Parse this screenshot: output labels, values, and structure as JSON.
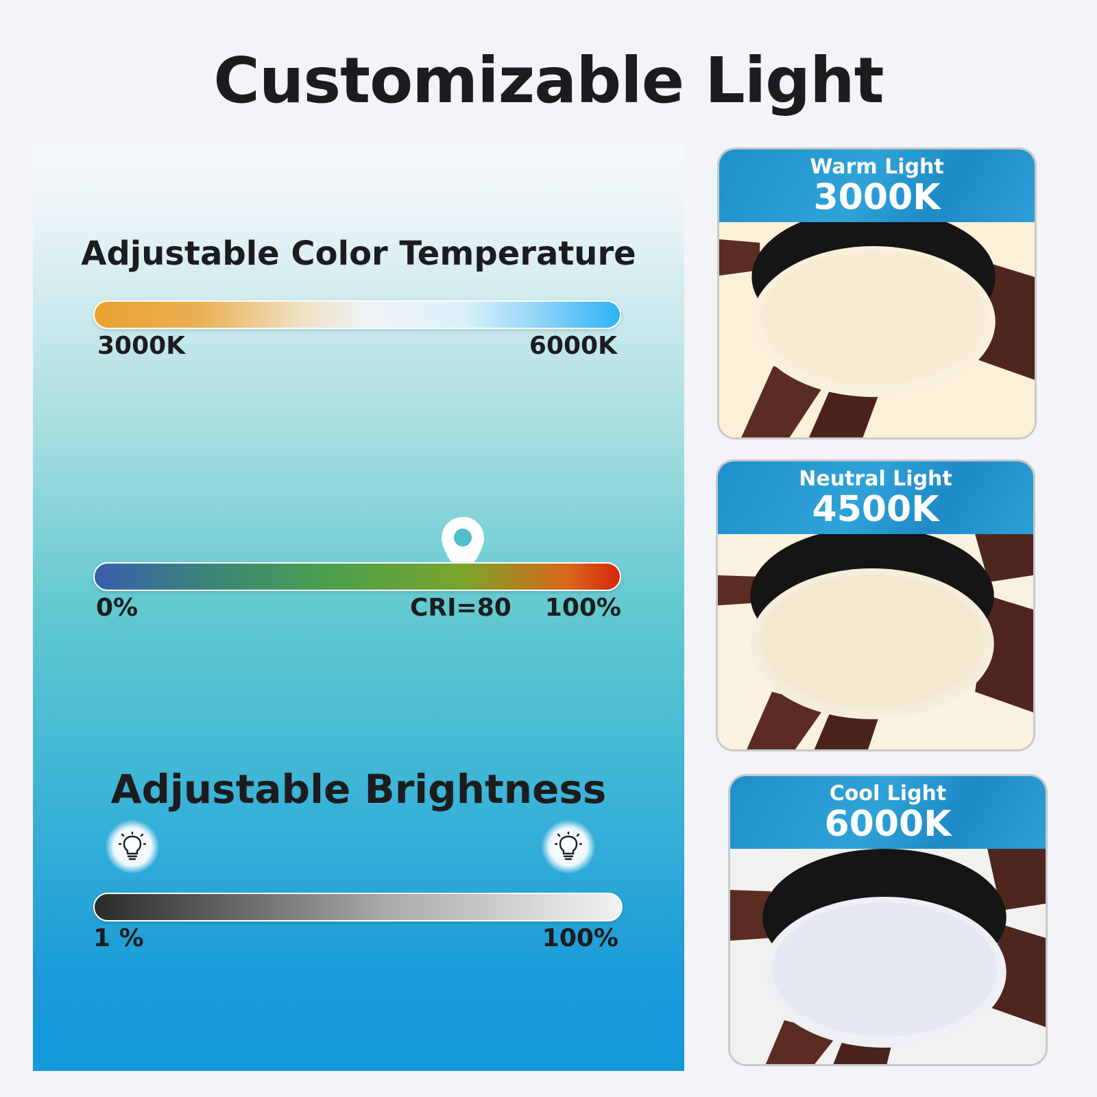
{
  "page": {
    "title": "Customizable Light"
  },
  "color_temperature": {
    "title": "Adjustable Color Temperature",
    "min_label": "3000K",
    "max_label": "6000K",
    "gradient_colors": [
      "#eaa131",
      "#eef3f6",
      "#2db3f7"
    ]
  },
  "cri": {
    "min_label": "0%",
    "value_label": "CRI=80",
    "max_label": "100%",
    "value": 80,
    "gradient_colors": [
      "#3a5fac",
      "#4aa04c",
      "#d8270e"
    ]
  },
  "brightness": {
    "title": "Adjustable Brightness",
    "min_label": "1 %",
    "max_label": "100%",
    "icon_low": "lightbulb-icon",
    "icon_high": "lightbulb-icon"
  },
  "light_modes": [
    {
      "name": "Warm Light",
      "kelvin": "3000K",
      "tint": "#fdf0d8"
    },
    {
      "name": "Neutral Light",
      "kelvin": "4500K",
      "tint": "#fbf1e1"
    },
    {
      "name": "Cool Light",
      "kelvin": "6000K",
      "tint": "#f1f2f0"
    }
  ]
}
